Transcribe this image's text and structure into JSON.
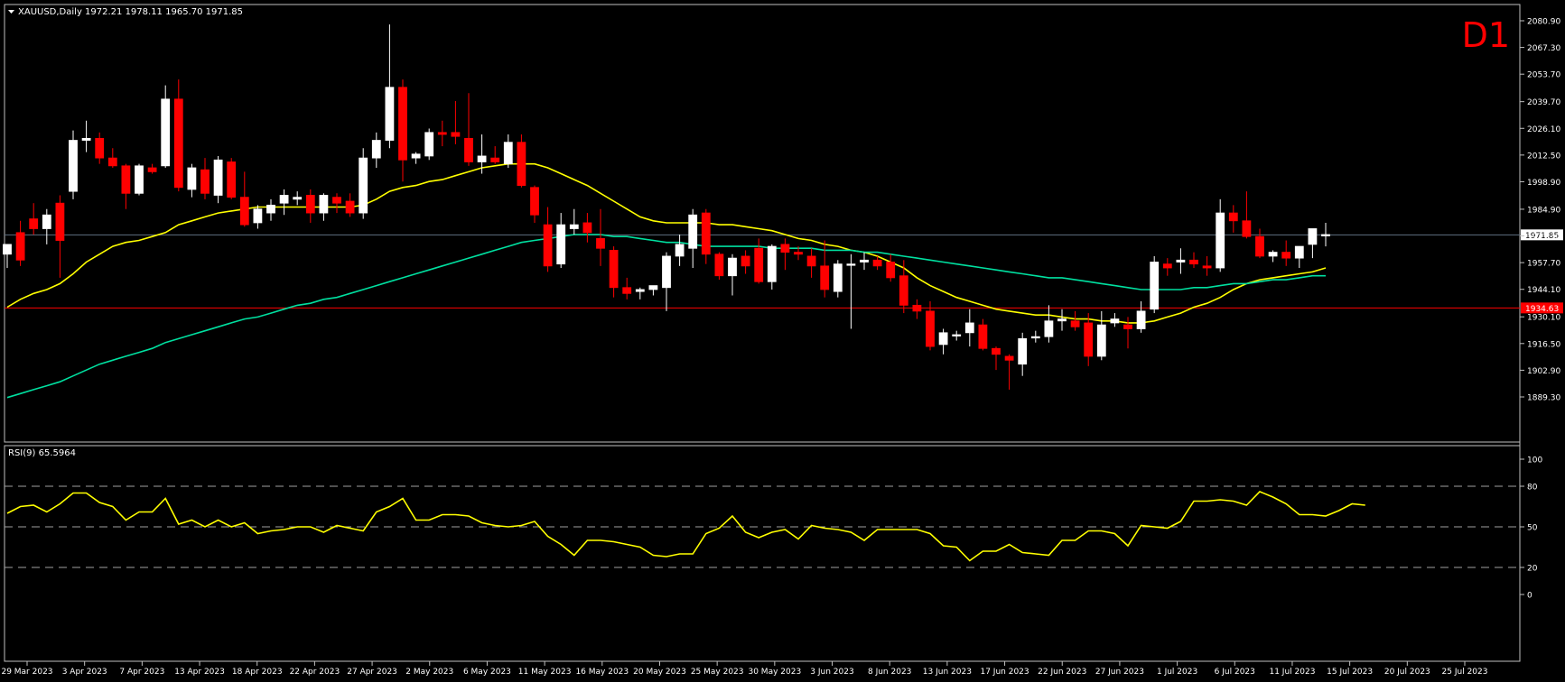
{
  "header": {
    "symbol_line": "XAUUSD,Daily  1972.21 1978.11 1965.70 1971.85",
    "timeframe_badge": "D1"
  },
  "rsi_header": "RSI(9) 65.5964",
  "colors": {
    "background": "#000000",
    "bull_candle": "#ffffff",
    "bear_candle": "#ff0000",
    "ma_fast": "#ffff00",
    "ma_slow": "#00e0a0",
    "rsi_line": "#ffff00",
    "support_line": "#ff0000",
    "price_line": "#607080",
    "badge": "#ff0000"
  },
  "chart_data": [
    {
      "type": "candlestick",
      "title": "XAUUSD,Daily",
      "ylim": [
        1889.3,
        2087.0
      ],
      "y_ticks": [
        2080.9,
        2067.3,
        2053.7,
        2039.7,
        2026.1,
        2012.5,
        1998.9,
        1984.9,
        1971.3,
        1957.7,
        1944.1,
        1930.1,
        1916.5,
        1902.9,
        1889.3
      ],
      "x_tick_labels": [
        "29 Mar 2023",
        "3 Apr 2023",
        "7 Apr 2023",
        "13 Apr 2023",
        "18 Apr 2023",
        "22 Apr 2023",
        "27 Apr 2023",
        "2 May 2023",
        "6 May 2023",
        "11 May 2023",
        "16 May 2023",
        "20 May 2023",
        "25 May 2023",
        "30 May 2023",
        "3 Jun 2023",
        "8 Jun 2023",
        "13 Jun 2023",
        "17 Jun 2023",
        "22 Jun 2023",
        "27 Jun 2023",
        "1 Jul 2023",
        "6 Jul 2023",
        "11 Jul 2023",
        "15 Jul 2023",
        "20 Jul 2023",
        "25 Jul 2023"
      ],
      "current_price_label": "1971.85",
      "horizontal_level_label": "1934.63",
      "candles": [
        {
          "o": 1962,
          "h": 1967,
          "l": 1955,
          "c": 1967
        },
        {
          "o": 1973,
          "h": 1979,
          "l": 1956,
          "c": 1959
        },
        {
          "o": 1980,
          "h": 1988,
          "l": 1972,
          "c": 1975
        },
        {
          "o": 1975,
          "h": 1985,
          "l": 1967,
          "c": 1982
        },
        {
          "o": 1988,
          "h": 1992,
          "l": 1950,
          "c": 1969
        },
        {
          "o": 1994,
          "h": 2025,
          "l": 1990,
          "c": 2020
        },
        {
          "o": 2020,
          "h": 2030,
          "l": 2014,
          "c": 2021
        },
        {
          "o": 2021,
          "h": 2024,
          "l": 2008,
          "c": 2011
        },
        {
          "o": 2011,
          "h": 2016,
          "l": 2006,
          "c": 2007
        },
        {
          "o": 2007,
          "h": 2008,
          "l": 1985,
          "c": 1993
        },
        {
          "o": 1993,
          "h": 2008,
          "l": 1992,
          "c": 2007
        },
        {
          "o": 2006,
          "h": 2008,
          "l": 2003,
          "c": 2004
        },
        {
          "o": 2007,
          "h": 2048,
          "l": 2006,
          "c": 2041
        },
        {
          "o": 2041,
          "h": 2051,
          "l": 1994,
          "c": 1996
        },
        {
          "o": 1995,
          "h": 2008,
          "l": 1991,
          "c": 2006
        },
        {
          "o": 2005,
          "h": 2011,
          "l": 1990,
          "c": 1993
        },
        {
          "o": 1992,
          "h": 2012,
          "l": 1988,
          "c": 2010
        },
        {
          "o": 2009,
          "h": 2011,
          "l": 1990,
          "c": 1991
        },
        {
          "o": 1991,
          "h": 2004,
          "l": 1976,
          "c": 1977
        },
        {
          "o": 1978,
          "h": 1987,
          "l": 1975,
          "c": 1985
        },
        {
          "o": 1983,
          "h": 1990,
          "l": 1979,
          "c": 1987
        },
        {
          "o": 1988,
          "h": 1995,
          "l": 1982,
          "c": 1992
        },
        {
          "o": 1990,
          "h": 1994,
          "l": 1987,
          "c": 1991
        },
        {
          "o": 1992,
          "h": 1995,
          "l": 1978,
          "c": 1983
        },
        {
          "o": 1983,
          "h": 1993,
          "l": 1979,
          "c": 1992
        },
        {
          "o": 1991,
          "h": 1993,
          "l": 1983,
          "c": 1988
        },
        {
          "o": 1989,
          "h": 1993,
          "l": 1981,
          "c": 1983
        },
        {
          "o": 1983,
          "h": 2016,
          "l": 1980,
          "c": 2011
        },
        {
          "o": 2011,
          "h": 2024,
          "l": 2006,
          "c": 2020
        },
        {
          "o": 2020,
          "h": 2079,
          "l": 2016,
          "c": 2047
        },
        {
          "o": 2047,
          "h": 2051,
          "l": 1999,
          "c": 2010
        },
        {
          "o": 2011,
          "h": 2014,
          "l": 2008,
          "c": 2013
        },
        {
          "o": 2012,
          "h": 2026,
          "l": 2010,
          "c": 2024
        },
        {
          "o": 2024,
          "h": 2030,
          "l": 2017,
          "c": 2023
        },
        {
          "o": 2024,
          "h": 2040,
          "l": 2018,
          "c": 2022
        },
        {
          "o": 2021,
          "h": 2044,
          "l": 2007,
          "c": 2009
        },
        {
          "o": 2009,
          "h": 2023,
          "l": 2003,
          "c": 2012
        },
        {
          "o": 2011,
          "h": 2017,
          "l": 2008,
          "c": 2009
        },
        {
          "o": 2008,
          "h": 2023,
          "l": 2006,
          "c": 2019
        },
        {
          "o": 2019,
          "h": 2023,
          "l": 1996,
          "c": 1997
        },
        {
          "o": 1996,
          "h": 1997,
          "l": 1978,
          "c": 1982
        },
        {
          "o": 1977,
          "h": 1986,
          "l": 1953,
          "c": 1956
        },
        {
          "o": 1957,
          "h": 1983,
          "l": 1955,
          "c": 1977
        },
        {
          "o": 1975,
          "h": 1985,
          "l": 1972,
          "c": 1977
        },
        {
          "o": 1978,
          "h": 1983,
          "l": 1968,
          "c": 1973
        },
        {
          "o": 1970,
          "h": 1985,
          "l": 1956,
          "c": 1965
        },
        {
          "o": 1964,
          "h": 1966,
          "l": 1940,
          "c": 1945
        },
        {
          "o": 1945,
          "h": 1950,
          "l": 1939,
          "c": 1942
        },
        {
          "o": 1943,
          "h": 1945,
          "l": 1939,
          "c": 1944
        },
        {
          "o": 1944,
          "h": 1946,
          "l": 1941,
          "c": 1946
        },
        {
          "o": 1945,
          "h": 1963,
          "l": 1933,
          "c": 1961
        },
        {
          "o": 1961,
          "h": 1972,
          "l": 1956,
          "c": 1967
        },
        {
          "o": 1965,
          "h": 1985,
          "l": 1955,
          "c": 1982
        },
        {
          "o": 1983,
          "h": 1985,
          "l": 1957,
          "c": 1962
        },
        {
          "o": 1962,
          "h": 1963,
          "l": 1949,
          "c": 1951
        },
        {
          "o": 1951,
          "h": 1962,
          "l": 1941,
          "c": 1960
        },
        {
          "o": 1961,
          "h": 1964,
          "l": 1952,
          "c": 1956
        },
        {
          "o": 1965,
          "h": 1970,
          "l": 1947,
          "c": 1948
        },
        {
          "o": 1948,
          "h": 1967,
          "l": 1944,
          "c": 1966
        },
        {
          "o": 1967,
          "h": 1970,
          "l": 1954,
          "c": 1963
        },
        {
          "o": 1963,
          "h": 1966,
          "l": 1959,
          "c": 1962
        },
        {
          "o": 1961,
          "h": 1965,
          "l": 1950,
          "c": 1956
        },
        {
          "o": 1956,
          "h": 1969,
          "l": 1940,
          "c": 1944
        },
        {
          "o": 1943,
          "h": 1959,
          "l": 1940,
          "c": 1957
        },
        {
          "o": 1957,
          "h": 1962,
          "l": 1924,
          "c": 1957
        },
        {
          "o": 1958,
          "h": 1963,
          "l": 1954,
          "c": 1959
        },
        {
          "o": 1959,
          "h": 1961,
          "l": 1954,
          "c": 1956
        },
        {
          "o": 1958,
          "h": 1962,
          "l": 1948,
          "c": 1950
        },
        {
          "o": 1951,
          "h": 1959,
          "l": 1932,
          "c": 1936
        },
        {
          "o": 1936,
          "h": 1939,
          "l": 1929,
          "c": 1933
        },
        {
          "o": 1933,
          "h": 1938,
          "l": 1913,
          "c": 1915
        },
        {
          "o": 1916,
          "h": 1924,
          "l": 1911,
          "c": 1922
        },
        {
          "o": 1921,
          "h": 1923,
          "l": 1918,
          "c": 1921
        },
        {
          "o": 1922,
          "h": 1934,
          "l": 1915,
          "c": 1927
        },
        {
          "o": 1926,
          "h": 1929,
          "l": 1913,
          "c": 1914
        },
        {
          "o": 1914,
          "h": 1915,
          "l": 1903,
          "c": 1911
        },
        {
          "o": 1910,
          "h": 1911,
          "l": 1893,
          "c": 1908
        },
        {
          "o": 1906,
          "h": 1922,
          "l": 1900,
          "c": 1919
        },
        {
          "o": 1920,
          "h": 1923,
          "l": 1917,
          "c": 1920
        },
        {
          "o": 1920,
          "h": 1936,
          "l": 1917,
          "c": 1928
        },
        {
          "o": 1928,
          "h": 1934,
          "l": 1923,
          "c": 1929
        },
        {
          "o": 1928,
          "h": 1933,
          "l": 1923,
          "c": 1925
        },
        {
          "o": 1927,
          "h": 1932,
          "l": 1905,
          "c": 1910
        },
        {
          "o": 1910,
          "h": 1933,
          "l": 1908,
          "c": 1926
        },
        {
          "o": 1927,
          "h": 1932,
          "l": 1925,
          "c": 1929
        },
        {
          "o": 1926,
          "h": 1930,
          "l": 1914,
          "c": 1924
        },
        {
          "o": 1924,
          "h": 1938,
          "l": 1922,
          "c": 1933
        },
        {
          "o": 1934,
          "h": 1961,
          "l": 1932,
          "c": 1958
        },
        {
          "o": 1957,
          "h": 1960,
          "l": 1951,
          "c": 1955
        },
        {
          "o": 1958,
          "h": 1965,
          "l": 1952,
          "c": 1959
        },
        {
          "o": 1959,
          "h": 1963,
          "l": 1955,
          "c": 1957
        },
        {
          "o": 1956,
          "h": 1961,
          "l": 1951,
          "c": 1955
        },
        {
          "o": 1955,
          "h": 1990,
          "l": 1953,
          "c": 1983
        },
        {
          "o": 1983,
          "h": 1987,
          "l": 1973,
          "c": 1979
        },
        {
          "o": 1979,
          "h": 1994,
          "l": 1970,
          "c": 1971
        },
        {
          "o": 1971,
          "h": 1975,
          "l": 1960,
          "c": 1961
        },
        {
          "o": 1961,
          "h": 1964,
          "l": 1958,
          "c": 1963
        },
        {
          "o": 1963,
          "h": 1969,
          "l": 1956,
          "c": 1960
        },
        {
          "o": 1960,
          "h": 1966,
          "l": 1955,
          "c": 1966
        },
        {
          "o": 1967,
          "h": 1975,
          "l": 1960,
          "c": 1975
        },
        {
          "o": 1972,
          "h": 1978,
          "l": 1966,
          "c": 1972
        }
      ],
      "series": [
        {
          "name": "",
          "values": [
            1935,
            1939,
            1942,
            1944,
            1947,
            1952,
            1958,
            1962,
            1966,
            1968,
            1969,
            1971,
            1973,
            1977,
            1979,
            1981,
            1983,
            1984,
            1985,
            1986,
            1986,
            1986,
            1986,
            1986,
            1986,
            1986,
            1986,
            1987,
            1990,
            1994,
            1996,
            1997,
            1999,
            2000,
            2002,
            2004,
            2006,
            2007,
            2008,
            2008,
            2008,
            2006,
            2003,
            2000,
            1997,
            1993,
            1989,
            1985,
            1981,
            1979,
            1978,
            1978,
            1978,
            1978,
            1977,
            1977,
            1976,
            1975,
            1974,
            1972,
            1970,
            1969,
            1967,
            1966,
            1964,
            1963,
            1961,
            1958,
            1955,
            1950,
            1946,
            1943,
            1940,
            1938,
            1936,
            1934,
            1933,
            1932,
            1931,
            1931,
            1930,
            1929,
            1929,
            1928,
            1928,
            1927,
            1927,
            1928,
            1930,
            1932,
            1935,
            1937,
            1940,
            1944,
            1947,
            1949,
            1950,
            1951,
            1952,
            1953,
            1955
          ]
        },
        {
          "name": "",
          "values": [
            1889,
            1891,
            1893,
            1895,
            1897,
            1900,
            1903,
            1906,
            1908,
            1910,
            1912,
            1914,
            1917,
            1919,
            1921,
            1923,
            1925,
            1927,
            1929,
            1930,
            1932,
            1934,
            1936,
            1937,
            1939,
            1940,
            1942,
            1944,
            1946,
            1948,
            1950,
            1952,
            1954,
            1956,
            1958,
            1960,
            1962,
            1964,
            1966,
            1968,
            1969,
            1970,
            1971,
            1972,
            1972,
            1972,
            1971,
            1971,
            1970,
            1969,
            1968,
            1968,
            1967,
            1966,
            1966,
            1966,
            1966,
            1966,
            1965,
            1965,
            1965,
            1965,
            1964,
            1964,
            1964,
            1963,
            1963,
            1962,
            1961,
            1960,
            1959,
            1958,
            1957,
            1956,
            1955,
            1954,
            1953,
            1952,
            1951,
            1950,
            1950,
            1949,
            1948,
            1947,
            1946,
            1945,
            1944,
            1944,
            1944,
            1944,
            1945,
            1945,
            1946,
            1947,
            1947,
            1948,
            1949,
            1949,
            1950,
            1951,
            1951
          ]
        }
      ]
    },
    {
      "type": "line",
      "title": "RSI(9) 65.5964",
      "ylim": [
        0,
        100
      ],
      "y_ticks": [
        100,
        80,
        50,
        20,
        0
      ],
      "dashed_levels": [
        80,
        50,
        20
      ],
      "series": [
        {
          "name": "RSI(9)",
          "values": [
            60,
            65,
            66,
            61,
            67,
            75,
            75,
            68,
            65,
            55,
            61,
            61,
            71,
            52,
            55,
            50,
            55,
            50,
            53,
            45,
            47,
            48,
            50,
            50,
            46,
            51,
            49,
            47,
            61,
            65,
            71,
            55,
            55,
            59,
            59,
            58,
            53,
            51,
            50,
            51,
            54,
            43,
            37,
            29,
            40,
            40,
            39,
            37,
            35,
            29,
            28,
            30,
            30,
            45,
            49,
            58,
            46,
            42,
            46,
            48,
            41,
            51,
            49,
            48,
            46,
            40,
            48,
            48,
            48,
            48,
            45,
            36,
            35,
            25,
            32,
            32,
            37,
            31,
            30,
            29,
            40,
            40,
            47,
            47,
            45,
            36,
            51,
            50,
            49,
            54,
            69,
            69,
            70,
            69,
            66,
            76,
            72,
            67,
            59,
            59,
            58,
            62,
            67,
            66
          ]
        }
      ]
    }
  ]
}
